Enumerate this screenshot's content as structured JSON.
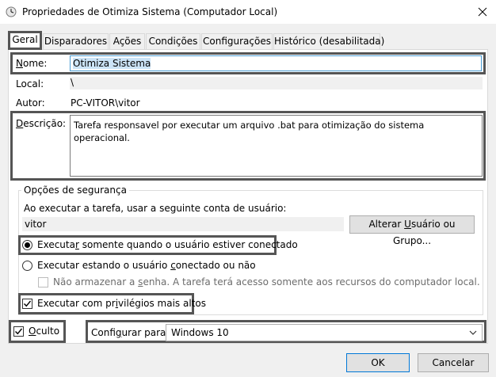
{
  "window": {
    "title": "Propriedades de Otimiza Sistema (Computador Local)",
    "close_symbol": "✕"
  },
  "tabs": [
    {
      "label": "Geral",
      "active": true
    },
    {
      "label": "Disparadores"
    },
    {
      "label": "Ações"
    },
    {
      "label": "Condições"
    },
    {
      "label": "Configurações"
    },
    {
      "label": "Histórico (desabilitada)"
    }
  ],
  "general": {
    "name_label_u": "N",
    "name_label_rest": "ome:",
    "name_value": "Otimiza Sistema",
    "location_label": "Local:",
    "location_value": "\\",
    "author_label": "Autor:",
    "author_value": "PC-VITOR\\vitor",
    "description_label_u": "D",
    "description_label_rest": "escrição:",
    "description_value": "Tarefa responsavel por executar um arquivo .bat para otimização do sistema operacional."
  },
  "security": {
    "legend": "Opções de segurança",
    "run_as_text": "Ao executar a tarefa, usar a seguinte conta de usuário:",
    "user_value": "vitor",
    "change_user_pre": "Alterar ",
    "change_user_u": "U",
    "change_user_post": "suário ou Grupo...",
    "radio_logged_pre": "Executa",
    "radio_logged_u": "r",
    "radio_logged_post": " somente quando o usuário estiver conectado",
    "radio_logged_selected": true,
    "radio_any_pre": "Executar estando o usuário ",
    "radio_any_u": "c",
    "radio_any_post": "onectado ou não",
    "no_store_pre": "Não armazenar a ",
    "no_store_u": "s",
    "no_store_post": "enha. A tarefa terá acesso somente aos recursos do computador local.",
    "highest_pre": "Executar com pr",
    "highest_u": "i",
    "highest_post": "vilégios mais altos",
    "highest_checked": true
  },
  "footer": {
    "hidden_u": "O",
    "hidden_rest": "culto",
    "hidden_checked": true,
    "configure_pre": "Confi",
    "configure_u": "g",
    "configure_post": "urar para:",
    "configure_value": "Windows 10",
    "ok_label": "OK",
    "cancel_label": "Cancelar"
  },
  "colors": {
    "accent": "#0078d7",
    "highlight_border": "#555555",
    "selection": "#cce4f7"
  },
  "icons": {
    "window": "clock-icon",
    "close": "close-icon",
    "dropdown": "chevron-down-icon"
  }
}
